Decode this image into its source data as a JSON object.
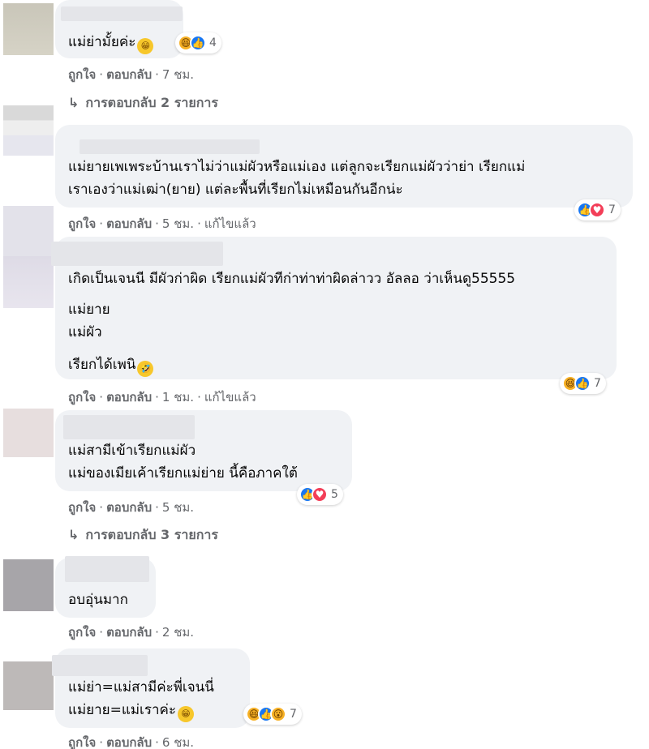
{
  "comments": [
    {
      "lines": [
        "แม่ย่ามั้ยค่ะ"
      ],
      "inline_emoji": "grin-emoji",
      "actions": {
        "like": "ถูกใจ",
        "reply": "ตอบกลับ",
        "time": "7 ชม."
      },
      "reactions": {
        "icons": [
          "haha",
          "like"
        ],
        "count": "4"
      },
      "replies": "การตอบกลับ 2 รายการ"
    },
    {
      "lines": [
        "แม่ยายเพเพระบ้านเราไม่ว่าแม่ผัวหรือแม่เอง แต่ลูกจะเรียกแม่ผัวว่าย่า เรียกแม่",
        "เราเองว่าแม่เฒ่า(ยาย) แต่ละพื้นที่เรียกไม่เหมือนกันอีกน่ะ"
      ],
      "actions": {
        "like": "ถูกใจ",
        "reply": "ตอบกลับ",
        "time": "5 ชม.",
        "edited": "แก้ไขแล้ว"
      },
      "reactions": {
        "icons": [
          "like",
          "love"
        ],
        "count": "7"
      }
    },
    {
      "lines": [
        "เกิดเป็นเจนนี มีผัวก่าผิด เรียกแม่ผัวทีก่าท่าท่าผิดล่าวว อัลลอ ว่าเห็นดู55555",
        "แม่ยาย",
        "แม่ผัว",
        "เรียกได้เพนิ"
      ],
      "inline_emoji": "laugh-emoji",
      "actions": {
        "like": "ถูกใจ",
        "reply": "ตอบกลับ",
        "time": "1 ชม.",
        "edited": "แก้ไขแล้ว"
      },
      "reactions": {
        "icons": [
          "haha",
          "like"
        ],
        "count": "7"
      }
    },
    {
      "lines": [
        "แม่สามีเข้าเรียกแม่ผัว",
        "แม่ของเมียเค้าเรียกแม่ย่าย นี้คือภาคใต้"
      ],
      "actions": {
        "like": "ถูกใจ",
        "reply": "ตอบกลับ",
        "time": "5 ชม."
      },
      "reactions": {
        "icons": [
          "like",
          "love"
        ],
        "count": "5"
      },
      "replies": "การตอบกลับ 3 รายการ"
    },
    {
      "lines": [
        "อบอุ่นมาก"
      ],
      "actions": {
        "like": "ถูกใจ",
        "reply": "ตอบกลับ",
        "time": "2 ชม."
      }
    },
    {
      "lines": [
        "แม่ย่า=แม่สามีค่ะพี่เจนนี่",
        "แม่ยาย=แม่เราค่ะ"
      ],
      "inline_emoji": "grin-emoji",
      "actions": {
        "like": "ถูกใจ",
        "reply": "ตอบกลับ",
        "time": "6 ชม."
      },
      "reactions": {
        "icons": [
          "haha",
          "like",
          "wow"
        ],
        "count": "7"
      }
    }
  ],
  "separator": "·",
  "reply_arrow": "↳",
  "colors": {
    "bubble": "#f0f2f5",
    "meta": "#65676b",
    "like": "#1877f2",
    "love": "#f33e58",
    "haha": "#f7b125"
  }
}
